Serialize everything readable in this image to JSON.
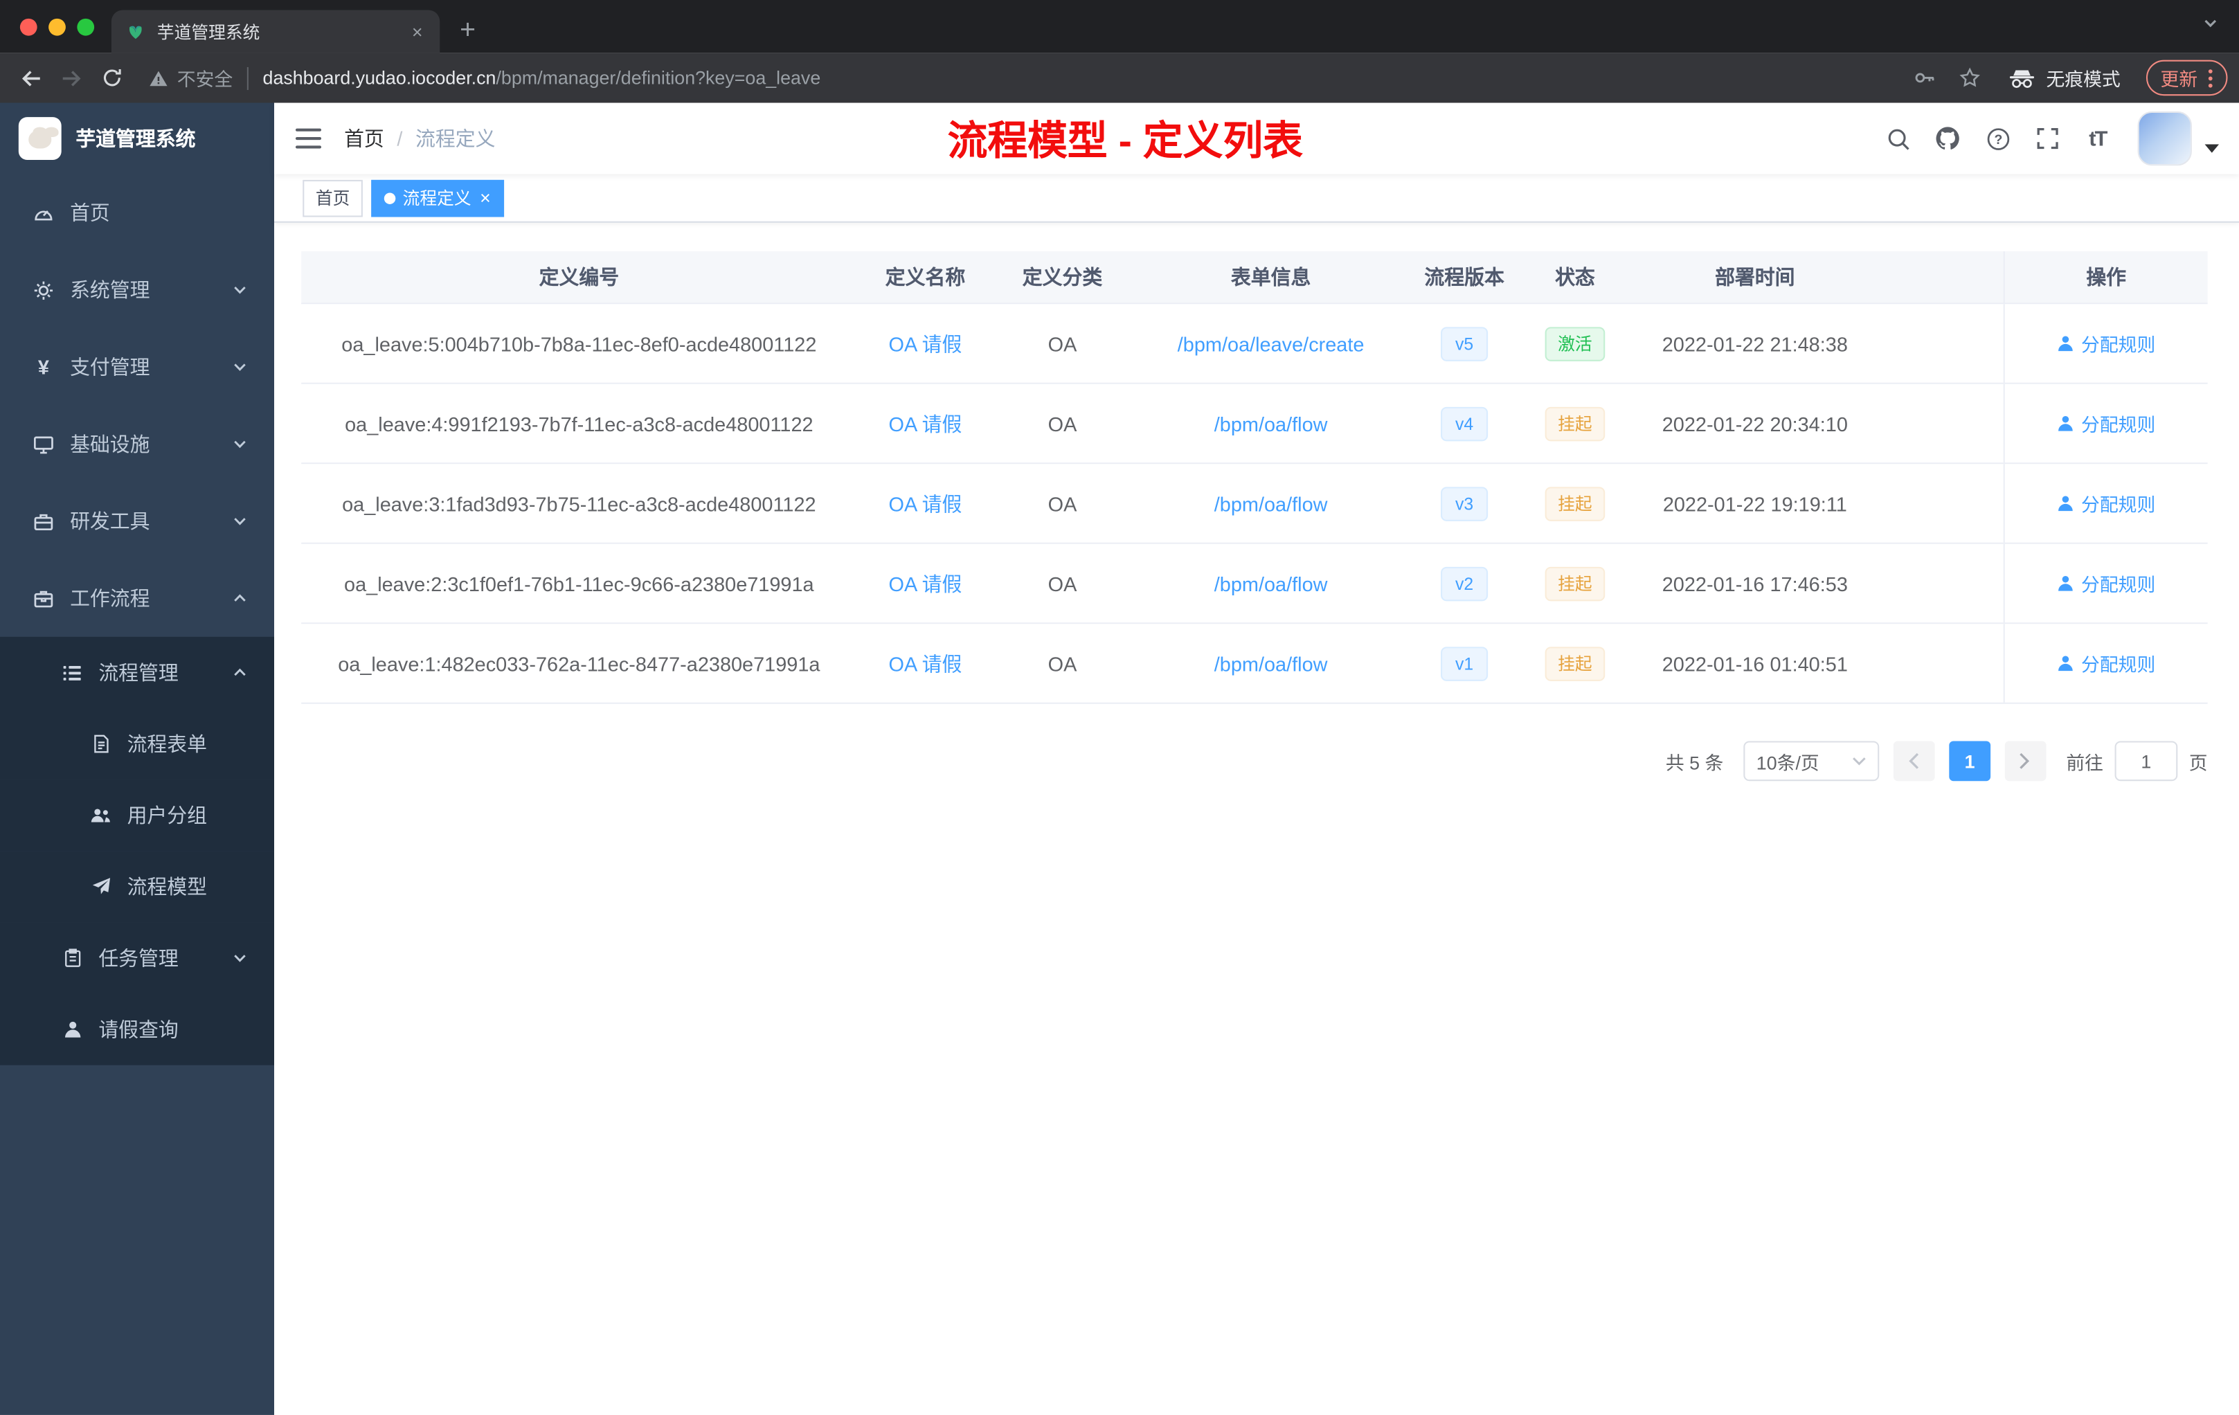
{
  "browser": {
    "tab_title": "芋道管理系统",
    "security_label": "不安全",
    "url_host": "dashboard.yudao.iocoder.cn",
    "url_path": "/bpm/manager/definition?key=oa_leave",
    "incognito_label": "无痕模式",
    "update_label": "更新"
  },
  "sidebar": {
    "logo_title": "芋道管理系统",
    "menu": [
      {
        "id": "home",
        "label": "首页",
        "icon": "dashboard-icon",
        "level": 1
      },
      {
        "id": "system-management",
        "label": "系统管理",
        "icon": "gear-icon",
        "level": 1,
        "arrow": "down"
      },
      {
        "id": "payment-management",
        "label": "支付管理",
        "icon": "yen-icon",
        "level": 1,
        "arrow": "down"
      },
      {
        "id": "infrastructure",
        "label": "基础设施",
        "icon": "monitor-icon",
        "level": 1,
        "arrow": "down"
      },
      {
        "id": "dev-tools",
        "label": "研发工具",
        "icon": "toolbox-icon",
        "level": 1,
        "arrow": "down"
      },
      {
        "id": "workflow",
        "label": "工作流程",
        "icon": "briefcase-icon",
        "level": 1,
        "arrow": "up"
      },
      {
        "id": "process-management",
        "label": "流程管理",
        "icon": "list-icon",
        "level": 2,
        "arrow": "up"
      },
      {
        "id": "process-form",
        "label": "流程表单",
        "icon": "document-icon",
        "level": 3
      },
      {
        "id": "user-group",
        "label": "用户分组",
        "icon": "users-icon",
        "level": 3
      },
      {
        "id": "process-model",
        "label": "流程模型",
        "icon": "send-icon",
        "level": 3
      },
      {
        "id": "task-management",
        "label": "任务管理",
        "icon": "clipboard-icon",
        "level": 2,
        "arrow": "down"
      },
      {
        "id": "leave-query",
        "label": "请假查询",
        "icon": "user-icon",
        "level": 2
      }
    ]
  },
  "header": {
    "breadcrumb_home": "首页",
    "breadcrumb_separator": "/",
    "breadcrumb_current": "流程定义",
    "page_title": "流程模型 - 定义列表"
  },
  "tags": [
    {
      "label": "首页",
      "active": false,
      "closable": false
    },
    {
      "label": "流程定义",
      "active": true,
      "closable": true
    }
  ],
  "table": {
    "columns": [
      "定义编号",
      "定义名称",
      "定义分类",
      "表单信息",
      "流程版本",
      "状态",
      "部署时间",
      "操作"
    ],
    "action_label": "分配规则",
    "rows": [
      {
        "id": "oa_leave:5:004b710b-7b8a-11ec-8ef0-acde48001122",
        "name": "OA 请假",
        "category": "OA",
        "form": "/bpm/oa/leave/create",
        "version": "v5",
        "status": "激活",
        "status_type": "success",
        "time": "2022-01-22 21:48:38"
      },
      {
        "id": "oa_leave:4:991f2193-7b7f-11ec-a3c8-acde48001122",
        "name": "OA 请假",
        "category": "OA",
        "form": "/bpm/oa/flow",
        "version": "v4",
        "status": "挂起",
        "status_type": "warning",
        "time": "2022-01-22 20:34:10"
      },
      {
        "id": "oa_leave:3:1fad3d93-7b75-11ec-a3c8-acde48001122",
        "name": "OA 请假",
        "category": "OA",
        "form": "/bpm/oa/flow",
        "version": "v3",
        "status": "挂起",
        "status_type": "warning",
        "time": "2022-01-22 19:19:11"
      },
      {
        "id": "oa_leave:2:3c1f0ef1-76b1-11ec-9c66-a2380e71991a",
        "name": "OA 请假",
        "category": "OA",
        "form": "/bpm/oa/flow",
        "version": "v2",
        "status": "挂起",
        "status_type": "warning",
        "time": "2022-01-16 17:46:53"
      },
      {
        "id": "oa_leave:1:482ec033-762a-11ec-8477-a2380e71991a",
        "name": "OA 请假",
        "category": "OA",
        "form": "/bpm/oa/flow",
        "version": "v1",
        "status": "挂起",
        "status_type": "warning",
        "time": "2022-01-16 01:40:51"
      }
    ]
  },
  "pagination": {
    "total_label": "共 5 条",
    "page_size_label": "10条/页",
    "current_page": "1",
    "goto_label": "前往",
    "goto_value": "1",
    "goto_unit": "页"
  },
  "colors": {
    "accent_blue": "#409eff",
    "title_red": "#f20d0d",
    "sidebar_bg": "#304156",
    "submenu_bg": "#1f2d3d",
    "status_success": "#1fbf52",
    "status_warning": "#e6a23c"
  }
}
